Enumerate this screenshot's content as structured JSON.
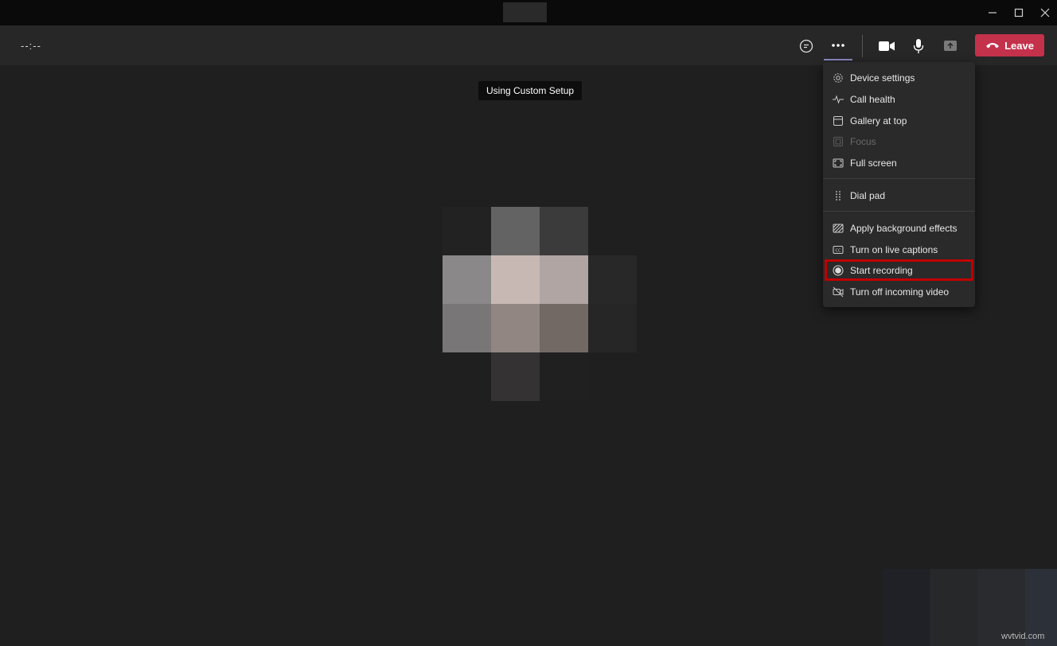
{
  "toolbar": {
    "timer": "--:--",
    "leave_label": "Leave"
  },
  "tooltip": "Using Custom Setup",
  "menu": {
    "items": [
      {
        "label": "Device settings",
        "icon": "gear-icon"
      },
      {
        "label": "Call health",
        "icon": "pulse-icon"
      },
      {
        "label": "Gallery at top",
        "icon": "gallery-icon"
      },
      {
        "label": "Focus",
        "icon": "focus-icon",
        "disabled": true
      },
      {
        "label": "Full screen",
        "icon": "fullscreen-icon"
      },
      {
        "label": "Dial pad",
        "icon": "dialpad-icon"
      },
      {
        "label": "Apply background effects",
        "icon": "background-effects-icon"
      },
      {
        "label": "Turn on live captions",
        "icon": "captions-icon"
      },
      {
        "label": "Start recording",
        "icon": "record-icon",
        "highlighted": true
      },
      {
        "label": "Turn off incoming video",
        "icon": "video-off-icon"
      }
    ]
  },
  "colors": {
    "leave": "#c4314b",
    "highlight_box": "#c00000",
    "active_underline": "#8b8cc7"
  },
  "watermark": "wvtvid.com"
}
